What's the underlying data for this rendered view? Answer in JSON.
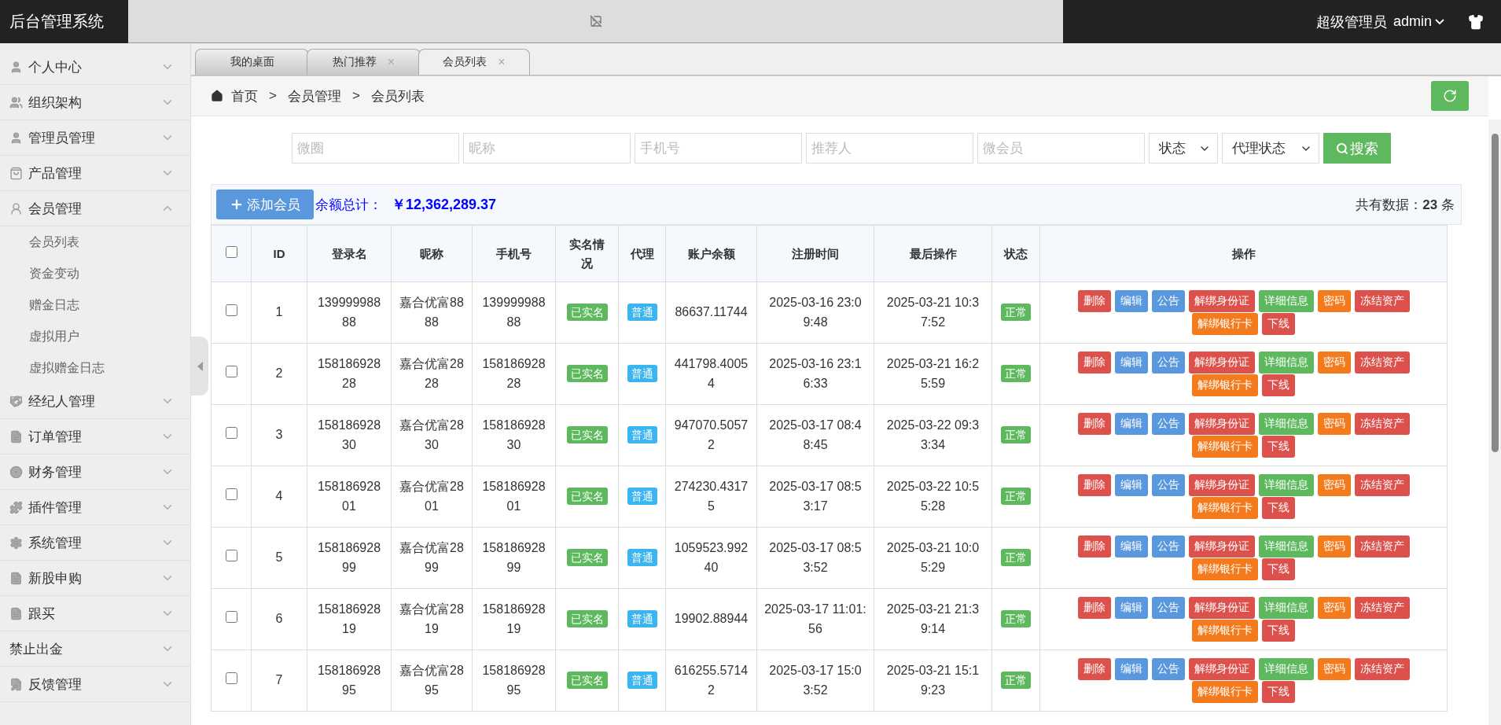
{
  "topbar": {
    "title": "后台管理系统",
    "role": "超级管理员",
    "user": "admin"
  },
  "sidebar": {
    "items": [
      {
        "label": "个人中心",
        "expanded": false
      },
      {
        "label": "组织架构",
        "expanded": false
      },
      {
        "label": "管理员管理",
        "expanded": false
      },
      {
        "label": "产品管理",
        "expanded": false
      },
      {
        "label": "会员管理",
        "expanded": true,
        "children": [
          {
            "label": "会员列表"
          },
          {
            "label": "资金变动"
          },
          {
            "label": "赠金日志"
          },
          {
            "label": "虚拟用户"
          },
          {
            "label": "虚拟赠金日志"
          }
        ]
      },
      {
        "label": "经纪人管理",
        "expanded": false
      },
      {
        "label": "订单管理",
        "expanded": false
      },
      {
        "label": "财务管理",
        "expanded": false
      },
      {
        "label": "插件管理",
        "expanded": false
      },
      {
        "label": "系统管理",
        "expanded": false
      },
      {
        "label": "新股申购",
        "expanded": false
      },
      {
        "label": "跟买",
        "expanded": false
      },
      {
        "label": "禁止出金",
        "expanded": false
      },
      {
        "label": "反馈管理",
        "expanded": false
      }
    ]
  },
  "tabs": [
    {
      "label": "我的桌面",
      "selected": false,
      "closable": false
    },
    {
      "label": "热门推荐",
      "selected": false,
      "closable": true
    },
    {
      "label": "会员列表",
      "selected": true,
      "closable": true
    }
  ],
  "tab_close": "×",
  "breadcrumb": {
    "items": [
      "首页",
      "会员管理",
      "会员列表"
    ],
    "separator": ">"
  },
  "filters": {
    "inputs": [
      {
        "placeholder": "微圈"
      },
      {
        "placeholder": "昵称"
      },
      {
        "placeholder": "手机号"
      },
      {
        "placeholder": "推荐人"
      },
      {
        "placeholder": "微会员"
      }
    ],
    "selects": [
      {
        "value": "状态"
      },
      {
        "value": "代理状态"
      }
    ],
    "search_button": "搜索"
  },
  "summary": {
    "add_button": "添加会员",
    "total_label": "余额总计：",
    "total_value": "￥12,362,289.37",
    "count_text": "共有数据：**23** 条"
  },
  "table": {
    "header_checked": false,
    "columns": [
      "ID",
      "登录名",
      "昵称",
      "手机号",
      "实名情况",
      "代理",
      "账户余额",
      "注册时间",
      "最后操作",
      "状态",
      "操作"
    ],
    "rows": [
      {
        "checked": false,
        "id": "1",
        "login": "13999998888",
        "nickname": "嘉合优富8888",
        "phone": "13999998888",
        "realname": "已实名",
        "agent": "普通",
        "balance": "86637.11744",
        "registered": "2025-03-16 23:09:48",
        "last_action": "2025-03-21 10:37:52",
        "status": "正常",
        "actions": [
          {
            "label": "删除",
            "kind": "danger"
          },
          {
            "label": "编辑",
            "kind": "primary"
          },
          {
            "label": "公告",
            "kind": "primary"
          },
          {
            "label": "解绑身份证",
            "kind": "danger"
          },
          {
            "label": "详细信息",
            "kind": "success"
          },
          {
            "label": "密码",
            "kind": "warning"
          },
          {
            "label": "冻结资产",
            "kind": "danger"
          },
          {
            "label": "解绑银行卡",
            "kind": "warning"
          },
          {
            "label": "下线",
            "kind": "danger"
          }
        ]
      },
      {
        "checked": false,
        "id": "2",
        "login": "15818692828",
        "nickname": "嘉合优富2828",
        "phone": "15818692828",
        "realname": "已实名",
        "agent": "普通",
        "balance": "441798.40054",
        "registered": "2025-03-16 23:16:33",
        "last_action": "2025-03-21 16:25:59",
        "status": "正常",
        "actions": [
          {
            "label": "删除",
            "kind": "danger"
          },
          {
            "label": "编辑",
            "kind": "primary"
          },
          {
            "label": "公告",
            "kind": "primary"
          },
          {
            "label": "解绑身份证",
            "kind": "danger"
          },
          {
            "label": "详细信息",
            "kind": "success"
          },
          {
            "label": "密码",
            "kind": "warning"
          },
          {
            "label": "冻结资产",
            "kind": "danger"
          },
          {
            "label": "解绑银行卡",
            "kind": "warning"
          },
          {
            "label": "下线",
            "kind": "danger"
          }
        ]
      },
      {
        "checked": false,
        "id": "3",
        "login": "15818692830",
        "nickname": "嘉合优富2830",
        "phone": "15818692830",
        "realname": "已实名",
        "agent": "普通",
        "balance": "947070.50572",
        "registered": "2025-03-17 08:48:45",
        "last_action": "2025-03-22 09:33:34",
        "status": "正常",
        "actions": [
          {
            "label": "删除",
            "kind": "danger"
          },
          {
            "label": "编辑",
            "kind": "primary"
          },
          {
            "label": "公告",
            "kind": "primary"
          },
          {
            "label": "解绑身份证",
            "kind": "danger"
          },
          {
            "label": "详细信息",
            "kind": "success"
          },
          {
            "label": "密码",
            "kind": "warning"
          },
          {
            "label": "冻结资产",
            "kind": "danger"
          },
          {
            "label": "解绑银行卡",
            "kind": "warning"
          },
          {
            "label": "下线",
            "kind": "danger"
          }
        ]
      },
      {
        "checked": false,
        "id": "4",
        "login": "15818692801",
        "nickname": "嘉合优富2801",
        "phone": "15818692801",
        "realname": "已实名",
        "agent": "普通",
        "balance": "274230.43175",
        "registered": "2025-03-17 08:53:17",
        "last_action": "2025-03-22 10:55:28",
        "status": "正常",
        "actions": [
          {
            "label": "删除",
            "kind": "danger"
          },
          {
            "label": "编辑",
            "kind": "primary"
          },
          {
            "label": "公告",
            "kind": "primary"
          },
          {
            "label": "解绑身份证",
            "kind": "danger"
          },
          {
            "label": "详细信息",
            "kind": "success"
          },
          {
            "label": "密码",
            "kind": "warning"
          },
          {
            "label": "冻结资产",
            "kind": "danger"
          },
          {
            "label": "解绑银行卡",
            "kind": "warning"
          },
          {
            "label": "下线",
            "kind": "danger"
          }
        ]
      },
      {
        "checked": false,
        "id": "5",
        "login": "15818692899",
        "nickname": "嘉合优富2899",
        "phone": "15818692899",
        "realname": "已实名",
        "agent": "普通",
        "balance": "1059523.99240",
        "registered": "2025-03-17 08:53:52",
        "last_action": "2025-03-21 10:05:29",
        "status": "正常",
        "actions": [
          {
            "label": "删除",
            "kind": "danger"
          },
          {
            "label": "编辑",
            "kind": "primary"
          },
          {
            "label": "公告",
            "kind": "primary"
          },
          {
            "label": "解绑身份证",
            "kind": "danger"
          },
          {
            "label": "详细信息",
            "kind": "success"
          },
          {
            "label": "密码",
            "kind": "warning"
          },
          {
            "label": "冻结资产",
            "kind": "danger"
          },
          {
            "label": "解绑银行卡",
            "kind": "warning"
          },
          {
            "label": "下线",
            "kind": "danger"
          }
        ]
      },
      {
        "checked": false,
        "id": "6",
        "login": "15818692819",
        "nickname": "嘉合优富2819",
        "phone": "15818692819",
        "realname": "已实名",
        "agent": "普通",
        "balance": "19902.88944",
        "registered": "2025-03-17 11:01:56",
        "last_action": "2025-03-21 21:39:14",
        "status": "正常",
        "actions": [
          {
            "label": "删除",
            "kind": "danger"
          },
          {
            "label": "编辑",
            "kind": "primary"
          },
          {
            "label": "公告",
            "kind": "primary"
          },
          {
            "label": "解绑身份证",
            "kind": "danger"
          },
          {
            "label": "详细信息",
            "kind": "success"
          },
          {
            "label": "密码",
            "kind": "warning"
          },
          {
            "label": "冻结资产",
            "kind": "danger"
          },
          {
            "label": "解绑银行卡",
            "kind": "warning"
          },
          {
            "label": "下线",
            "kind": "danger"
          }
        ]
      },
      {
        "checked": false,
        "id": "7",
        "login": "15818692895",
        "nickname": "嘉合优富2895",
        "phone": "15818692895",
        "realname": "已实名",
        "agent": "普通",
        "balance": "616255.57142",
        "registered": "2025-03-17 15:03:52",
        "last_action": "2025-03-21 15:19:23",
        "status": "正常",
        "actions": [
          {
            "label": "删除",
            "kind": "danger"
          },
          {
            "label": "编辑",
            "kind": "primary"
          },
          {
            "label": "公告",
            "kind": "primary"
          },
          {
            "label": "解绑身份证",
            "kind": "danger"
          },
          {
            "label": "详细信息",
            "kind": "success"
          },
          {
            "label": "密码",
            "kind": "warning"
          },
          {
            "label": "冻结资产",
            "kind": "danger"
          },
          {
            "label": "解绑银行卡",
            "kind": "warning"
          },
          {
            "label": "下线",
            "kind": "danger"
          }
        ]
      }
    ]
  }
}
